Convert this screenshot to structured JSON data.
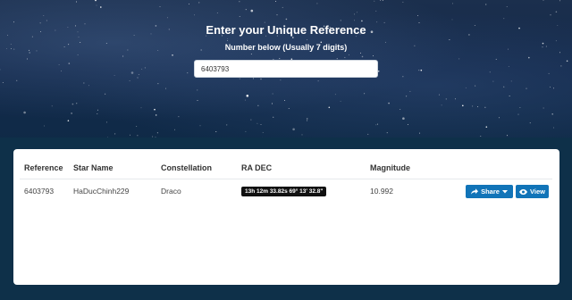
{
  "hero": {
    "title": "Enter your Unique Reference",
    "subtitle": "Number below (Usually 7 digits)",
    "input_value": "6403793"
  },
  "table": {
    "headers": [
      "Reference",
      "Star Name",
      "Constellation",
      "RA DEC",
      "Magnitude"
    ],
    "row": {
      "reference": "6403793",
      "star_name": "HaDucChinh229",
      "constellation": "Draco",
      "ra_dec": "13h 12m 33.82s 69° 13' 32.8\"",
      "magnitude": "10.992"
    },
    "share_label": "Share",
    "view_label": "View"
  },
  "colors": {
    "accent": "#1174b8",
    "band": "#0e3049"
  },
  "icons": [
    "share-icon",
    "caret-down-icon",
    "eye-icon"
  ]
}
